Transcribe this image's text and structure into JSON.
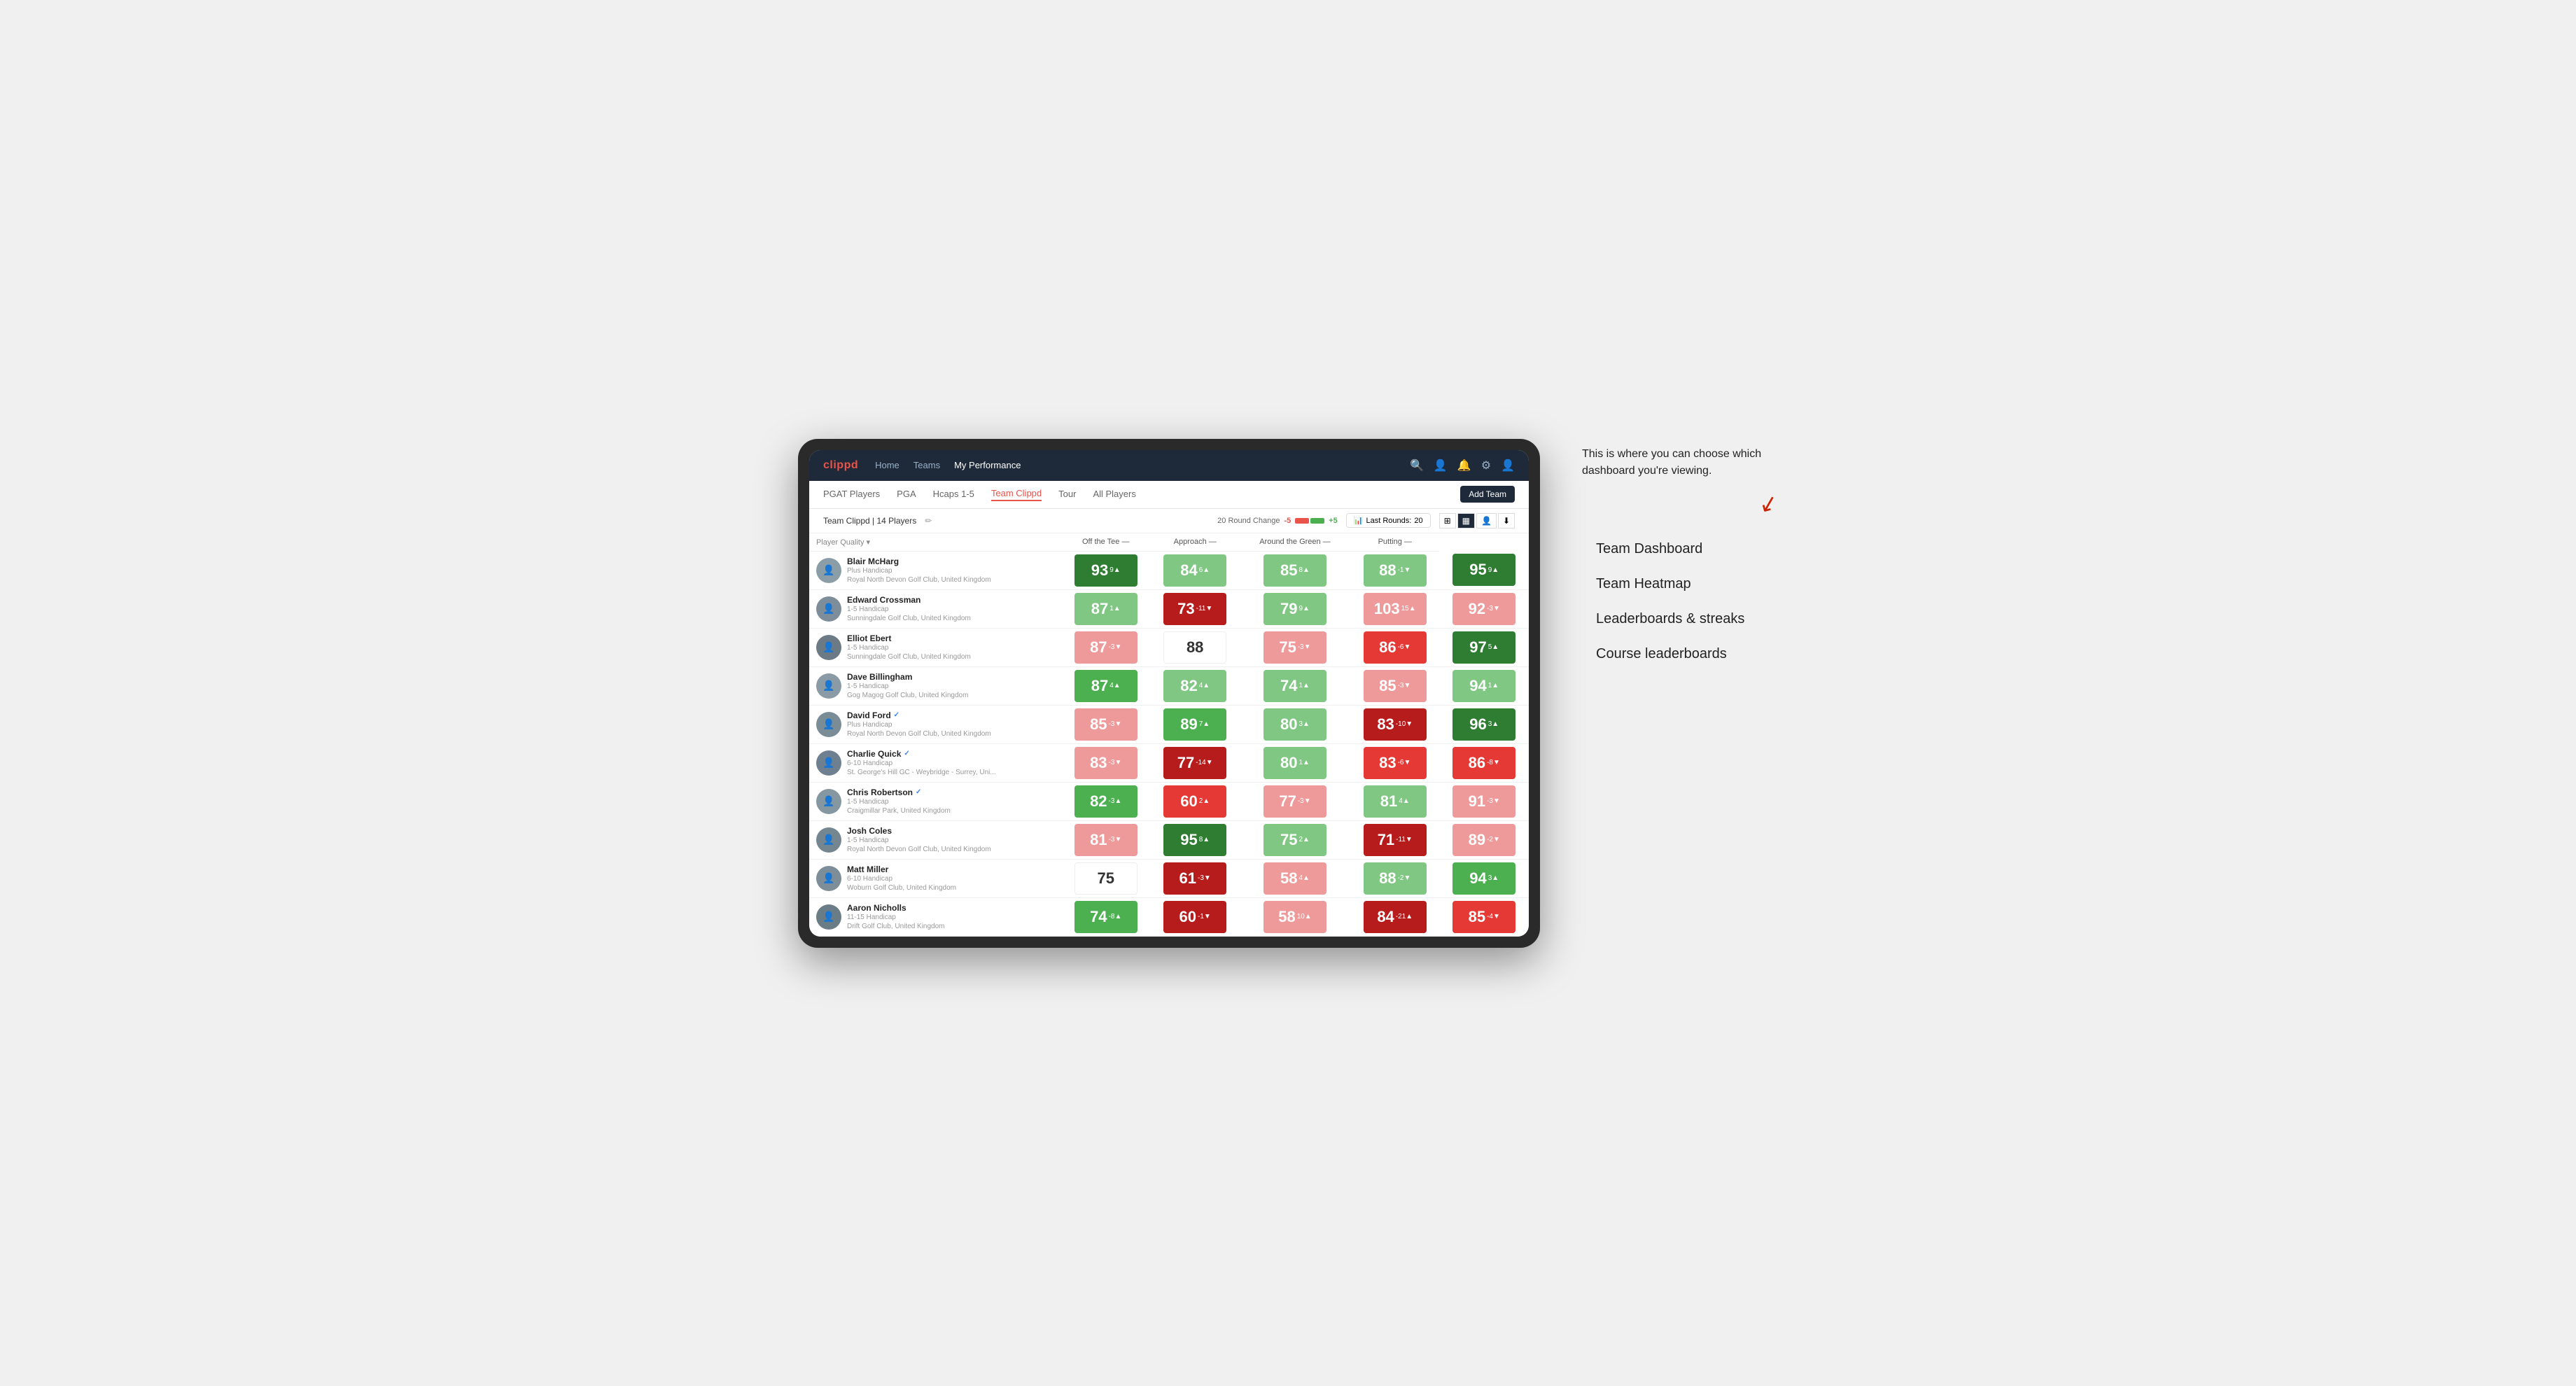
{
  "annotation": {
    "intro_text": "This is where you can choose which dashboard you're viewing.",
    "items": [
      "Team Dashboard",
      "Team Heatmap",
      "Leaderboards & streaks",
      "Course leaderboards"
    ]
  },
  "nav": {
    "logo": "clippd",
    "links": [
      {
        "label": "Home",
        "active": false
      },
      {
        "label": "Teams",
        "active": false
      },
      {
        "label": "My Performance",
        "active": true
      }
    ]
  },
  "sub_nav": {
    "links": [
      {
        "label": "PGAT Players",
        "active": false
      },
      {
        "label": "PGA",
        "active": false
      },
      {
        "label": "Hcaps 1-5",
        "active": false
      },
      {
        "label": "Team Clippd",
        "active": true
      },
      {
        "label": "Tour",
        "active": false
      },
      {
        "label": "All Players",
        "active": false
      }
    ],
    "add_team_label": "Add Team"
  },
  "toolbar": {
    "team_label": "Team Clippd",
    "player_count": "14 Players",
    "round_change_label": "20 Round Change",
    "neg_val": "-5",
    "pos_val": "+5",
    "last_rounds_label": "Last Rounds:",
    "last_rounds_val": "20"
  },
  "table": {
    "headers": {
      "player": "Player Quality",
      "off_tee": "Off the Tee",
      "approach": "Approach",
      "around_green": "Around the Green",
      "putting": "Putting"
    },
    "players": [
      {
        "name": "Blair McHarg",
        "handicap": "Plus Handicap",
        "club": "Royal North Devon Golf Club, United Kingdom",
        "avatar_bg": "#8B9EA8",
        "avatar_emoji": "👤",
        "scores": [
          {
            "value": "93",
            "delta": "9▲",
            "color": "green-dark"
          },
          {
            "value": "84",
            "delta": "6▲",
            "color": "green-light"
          },
          {
            "value": "85",
            "delta": "8▲",
            "color": "green-light"
          },
          {
            "value": "88",
            "delta": "-1▼",
            "color": "green-light"
          },
          {
            "value": "95",
            "delta": "9▲",
            "color": "green-dark"
          }
        ]
      },
      {
        "name": "Edward Crossman",
        "handicap": "1-5 Handicap",
        "club": "Sunningdale Golf Club, United Kingdom",
        "avatar_bg": "#7D8E9A",
        "avatar_emoji": "👤",
        "scores": [
          {
            "value": "87",
            "delta": "1▲",
            "color": "green-light"
          },
          {
            "value": "73",
            "delta": "-11▼",
            "color": "red-dark"
          },
          {
            "value": "79",
            "delta": "9▲",
            "color": "green-light"
          },
          {
            "value": "103",
            "delta": "15▲",
            "color": "red-light"
          },
          {
            "value": "92",
            "delta": "-3▼",
            "color": "red-light"
          }
        ]
      },
      {
        "name": "Elliot Ebert",
        "handicap": "1-5 Handicap",
        "club": "Sunningdale Golf Club, United Kingdom",
        "avatar_bg": "#6B7A84",
        "avatar_emoji": "👤",
        "scores": [
          {
            "value": "87",
            "delta": "-3▼",
            "color": "red-light"
          },
          {
            "value": "88",
            "delta": "",
            "color": "white"
          },
          {
            "value": "75",
            "delta": "-3▼",
            "color": "red-light"
          },
          {
            "value": "86",
            "delta": "-6▼",
            "color": "red-med"
          },
          {
            "value": "97",
            "delta": "5▲",
            "color": "green-dark"
          }
        ]
      },
      {
        "name": "Dave Billingham",
        "handicap": "1-5 Handicap",
        "club": "Gog Magog Golf Club, United Kingdom",
        "avatar_bg": "#8A9BA5",
        "avatar_emoji": "👤",
        "scores": [
          {
            "value": "87",
            "delta": "4▲",
            "color": "green-med"
          },
          {
            "value": "82",
            "delta": "4▲",
            "color": "green-light"
          },
          {
            "value": "74",
            "delta": "1▲",
            "color": "green-light"
          },
          {
            "value": "85",
            "delta": "-3▼",
            "color": "red-light"
          },
          {
            "value": "94",
            "delta": "1▲",
            "color": "green-light"
          }
        ]
      },
      {
        "name": "David Ford",
        "handicap": "Plus Handicap",
        "club": "Royal North Devon Golf Club, United Kingdom",
        "avatar_bg": "#7A8C96",
        "avatar_emoji": "👤",
        "verified": true,
        "scores": [
          {
            "value": "85",
            "delta": "-3▼",
            "color": "red-light"
          },
          {
            "value": "89",
            "delta": "7▲",
            "color": "green-med"
          },
          {
            "value": "80",
            "delta": "3▲",
            "color": "green-light"
          },
          {
            "value": "83",
            "delta": "-10▼",
            "color": "red-dark"
          },
          {
            "value": "96",
            "delta": "3▲",
            "color": "green-dark"
          }
        ]
      },
      {
        "name": "Charlie Quick",
        "handicap": "6-10 Handicap",
        "club": "St. George's Hill GC - Weybridge - Surrey, Uni...",
        "avatar_bg": "#6E8090",
        "avatar_emoji": "👤",
        "verified": true,
        "scores": [
          {
            "value": "83",
            "delta": "-3▼",
            "color": "red-light"
          },
          {
            "value": "77",
            "delta": "-14▼",
            "color": "red-dark"
          },
          {
            "value": "80",
            "delta": "1▲",
            "color": "green-light"
          },
          {
            "value": "83",
            "delta": "-6▼",
            "color": "red-med"
          },
          {
            "value": "86",
            "delta": "-8▼",
            "color": "red-med"
          }
        ]
      },
      {
        "name": "Chris Robertson",
        "handicap": "1-5 Handicap",
        "club": "Craigmillar Park, United Kingdom",
        "avatar_bg": "#8597A1",
        "avatar_emoji": "👤",
        "verified": true,
        "scores": [
          {
            "value": "82",
            "delta": "-3▲",
            "color": "green-med"
          },
          {
            "value": "60",
            "delta": "2▲",
            "color": "red-med"
          },
          {
            "value": "77",
            "delta": "-3▼",
            "color": "red-light"
          },
          {
            "value": "81",
            "delta": "4▲",
            "color": "green-light"
          },
          {
            "value": "91",
            "delta": "-3▼",
            "color": "red-light"
          }
        ]
      },
      {
        "name": "Josh Coles",
        "handicap": "1-5 Handicap",
        "club": "Royal North Devon Golf Club, United Kingdom",
        "avatar_bg": "#74868F",
        "avatar_emoji": "👤",
        "scores": [
          {
            "value": "81",
            "delta": "-3▼",
            "color": "red-light"
          },
          {
            "value": "95",
            "delta": "8▲",
            "color": "green-dark"
          },
          {
            "value": "75",
            "delta": "2▲",
            "color": "green-light"
          },
          {
            "value": "71",
            "delta": "-11▼",
            "color": "red-dark"
          },
          {
            "value": "89",
            "delta": "-2▼",
            "color": "red-light"
          }
        ]
      },
      {
        "name": "Matt Miller",
        "handicap": "6-10 Handicap",
        "club": "Woburn Golf Club, United Kingdom",
        "avatar_bg": "#7D8E99",
        "avatar_emoji": "👤",
        "scores": [
          {
            "value": "75",
            "delta": "",
            "color": "white"
          },
          {
            "value": "61",
            "delta": "-3▼",
            "color": "red-dark"
          },
          {
            "value": "58",
            "delta": "4▲",
            "color": "red-light"
          },
          {
            "value": "88",
            "delta": "-2▼",
            "color": "green-light"
          },
          {
            "value": "94",
            "delta": "3▲",
            "color": "green-med"
          }
        ]
      },
      {
        "name": "Aaron Nicholls",
        "handicap": "11-15 Handicap",
        "club": "Drift Golf Club, United Kingdom",
        "avatar_bg": "#6A7C86",
        "avatar_emoji": "👤",
        "scores": [
          {
            "value": "74",
            "delta": "-8▲",
            "color": "green-med"
          },
          {
            "value": "60",
            "delta": "-1▼",
            "color": "red-dark"
          },
          {
            "value": "58",
            "delta": "10▲",
            "color": "red-light"
          },
          {
            "value": "84",
            "delta": "-21▲",
            "color": "red-dark"
          },
          {
            "value": "85",
            "delta": "-4▼",
            "color": "red-med"
          }
        ]
      }
    ]
  }
}
